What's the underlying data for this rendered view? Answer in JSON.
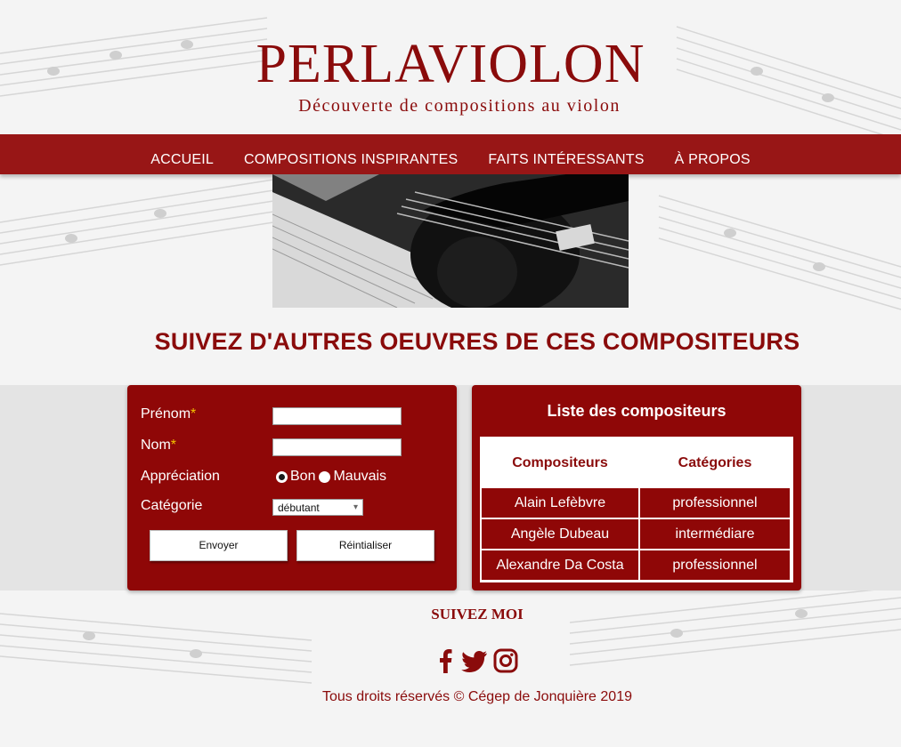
{
  "header": {
    "title": "PERLAVIOLON",
    "subtitle": "Découverte de compositions au violon"
  },
  "nav": {
    "items": [
      {
        "label": "ACCUEIL"
      },
      {
        "label": "COMPOSITIONS INSPIRANTES"
      },
      {
        "label": "FAITS INTÉRESSANTS"
      },
      {
        "label": "À PROPOS"
      }
    ]
  },
  "main": {
    "heading": "SUIVEZ D'AUTRES OEUVRES DE CES COMPOSITEURS"
  },
  "form": {
    "prenom_label": "Prénom",
    "nom_label": "Nom",
    "required_mark": "*",
    "prenom_value": "",
    "nom_value": "",
    "appreciation_label": "Appréciation",
    "appreciation_options": [
      "Bon",
      "Mauvais"
    ],
    "appreciation_selected": "Bon",
    "categorie_label": "Catégorie",
    "categorie_selected": "débutant",
    "submit_label": "Envoyer",
    "reset_label": "Réintialiser"
  },
  "composers": {
    "title": "Liste des compositeurs",
    "columns": [
      "Compositeurs",
      "Catégories"
    ],
    "rows": [
      {
        "name": "Alain Lefèbvre",
        "category": "professionnel"
      },
      {
        "name": "Angèle Dubeau",
        "category": "intermédiare"
      },
      {
        "name": "Alexandre Da Costa",
        "category": "professionnel"
      }
    ]
  },
  "footer": {
    "follow_label": "SUIVEZ MOI",
    "social_icons": [
      "facebook-icon",
      "twitter-icon",
      "instagram-icon"
    ],
    "copyright": "Tous droits réservés © Cégep de Jonquière 2019"
  },
  "colors": {
    "brand_red": "#8a0b0b",
    "nav_red": "#981616",
    "accent_yellow": "#f2c200"
  }
}
